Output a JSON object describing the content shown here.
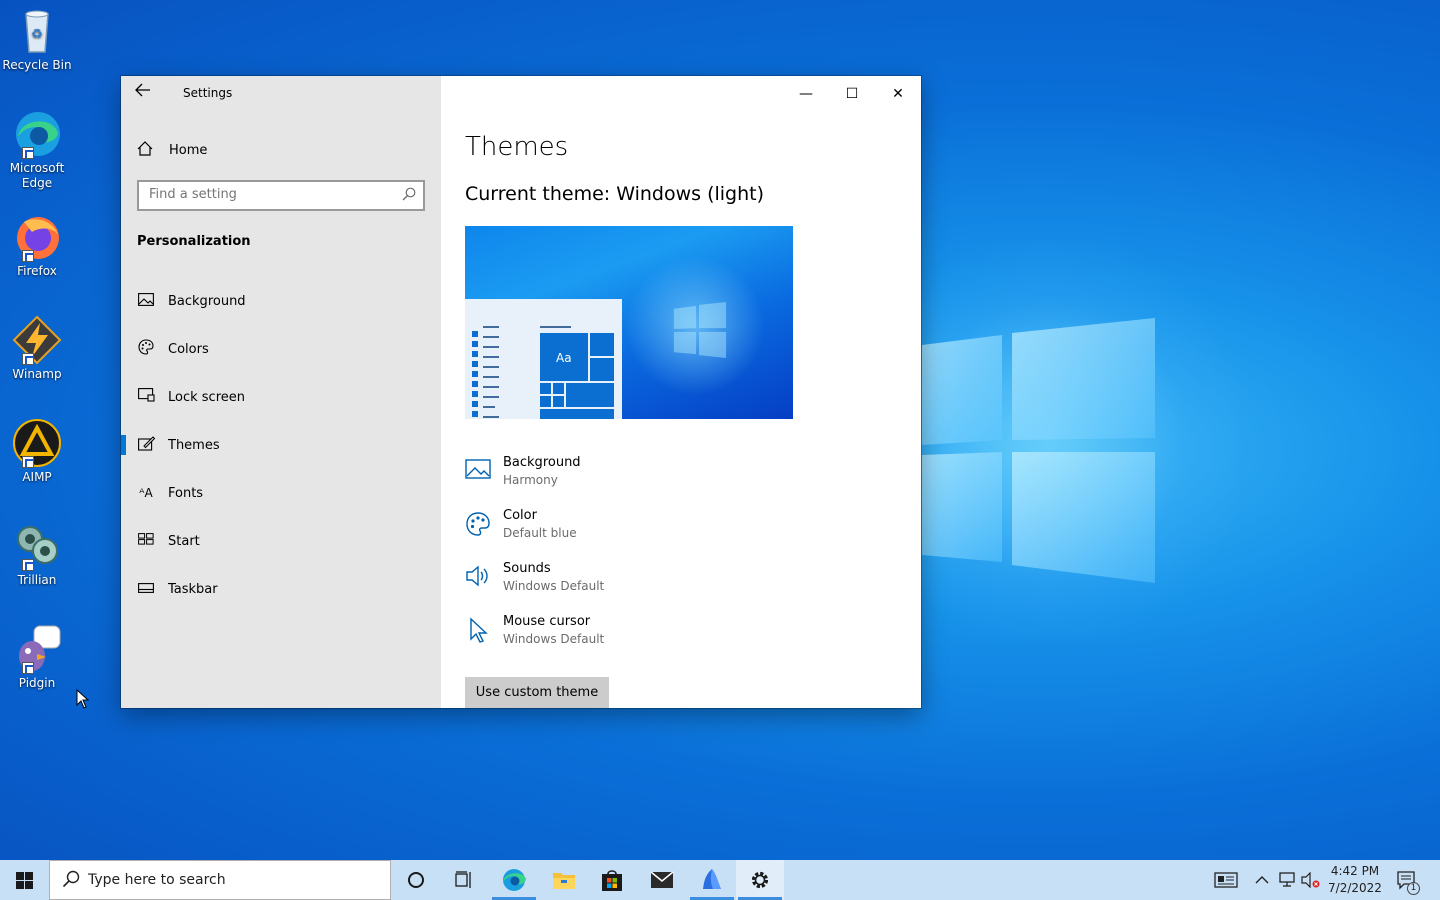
{
  "desktop": {
    "icons": [
      {
        "label": "Recycle Bin"
      },
      {
        "label": "Microsoft Edge"
      },
      {
        "label": "Firefox"
      },
      {
        "label": "Winamp"
      },
      {
        "label": "AIMP"
      },
      {
        "label": "Trillian"
      },
      {
        "label": "Pidgin"
      }
    ]
  },
  "window": {
    "title": "Settings",
    "controls": {
      "minimize": "—",
      "maximize": "☐",
      "close": "✕"
    }
  },
  "sidebar": {
    "home": "Home",
    "search_placeholder": "Find a setting",
    "section": "Personalization",
    "items": [
      {
        "label": "Background",
        "icon": "image-icon"
      },
      {
        "label": "Colors",
        "icon": "palette-icon"
      },
      {
        "label": "Lock screen",
        "icon": "lock-screen-icon"
      },
      {
        "label": "Themes",
        "icon": "themes-icon",
        "active": true
      },
      {
        "label": "Fonts",
        "icon": "fonts-icon"
      },
      {
        "label": "Start",
        "icon": "start-icon"
      },
      {
        "label": "Taskbar",
        "icon": "taskbar-icon"
      }
    ]
  },
  "main": {
    "heading": "Themes",
    "current_theme": "Current theme: Windows (light)",
    "preview_tile": "Aa",
    "options": [
      {
        "title": "Background",
        "value": "Harmony",
        "icon": "image-icon"
      },
      {
        "title": "Color",
        "value": "Default blue",
        "icon": "palette-icon"
      },
      {
        "title": "Sounds",
        "value": "Windows Default",
        "icon": "speaker-icon"
      },
      {
        "title": "Mouse cursor",
        "value": "Windows Default",
        "icon": "cursor-icon"
      }
    ],
    "custom_button": "Use custom theme"
  },
  "taskbar": {
    "search_placeholder": "Type here to search",
    "time": "4:42 PM",
    "date": "7/2/2022",
    "notification_count": "1"
  },
  "colors": {
    "accent": "#0078d7",
    "sidebar_bg": "#e6e6e6",
    "taskbar_bg": "#c8e0f5"
  }
}
